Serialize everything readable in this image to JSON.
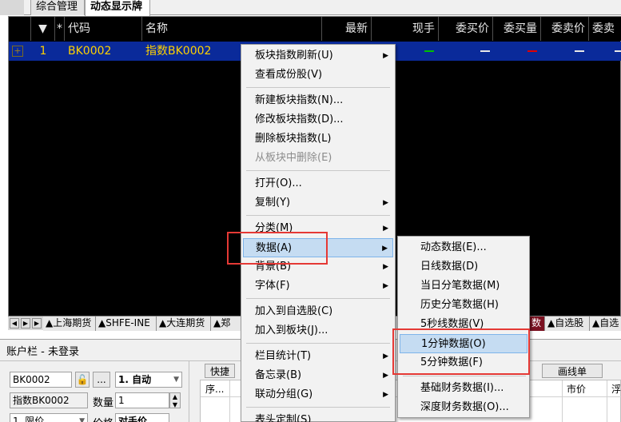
{
  "top_tabs": [
    {
      "label": "综合管理"
    },
    {
      "label": "动态显示牌"
    }
  ],
  "grid": {
    "headers": {
      "sort": "▼",
      "star": "*",
      "code": "代码",
      "name": "名称",
      "latest": "最新",
      "current": "现手",
      "bid_price": "委买价",
      "bid_vol": "委买量",
      "ask_price": "委卖价",
      "ask_vol": "委卖"
    },
    "row": {
      "expand": "+",
      "index": "1",
      "code": "BK0002",
      "name": "指数BK0002"
    },
    "colors": {
      "bg": "#000000",
      "row_bg": "#0a2a9a",
      "row_text": "#ffd200",
      "green": "#00c000",
      "red": "#e00000"
    }
  },
  "category_tabs": {
    "tabs": [
      {
        "label": "▲上海期货"
      },
      {
        "label": "▲SHFE-INE"
      },
      {
        "label": "▲大连期货"
      },
      {
        "label": "▲郑"
      }
    ],
    "right_tabs": [
      {
        "label": "数"
      },
      {
        "label": "▲自选股"
      },
      {
        "label": "▲自选"
      }
    ]
  },
  "account": {
    "title": "账户栏 - 未登录",
    "code_value": "BK0002",
    "dots": "...",
    "mode": "1. 自动",
    "name_value": "指数BK0002",
    "qty_label": "数量",
    "qty_value": "1",
    "order_type": "1. 限价",
    "price_label": "价格",
    "price_value": "对手价",
    "quick_button": "快捷",
    "draw_button": "画线单",
    "col_seq": "序...",
    "col_market": "市价",
    "col_last": "浮"
  },
  "context_menu": {
    "items": [
      {
        "label": "板块指数刷新(U)",
        "arrow": "▶",
        "disabled": false
      },
      {
        "label": "查看成份股(V)",
        "arrow": "",
        "disabled": false
      },
      {
        "label": "新建板块指数(N)...",
        "arrow": "",
        "disabled": false
      },
      {
        "label": "修改板块指数(D)...",
        "arrow": "",
        "disabled": false
      },
      {
        "label": "删除板块指数(L)",
        "arrow": "",
        "disabled": false
      },
      {
        "label": "从板块中删除(E)",
        "arrow": "",
        "disabled": true
      },
      {
        "label": "打开(O)...",
        "arrow": "",
        "disabled": false
      },
      {
        "label": "复制(Y)",
        "arrow": "▶",
        "disabled": false
      },
      {
        "label": "分类(M)",
        "arrow": "▶",
        "disabled": false
      },
      {
        "label": "数据(A)",
        "arrow": "▶",
        "disabled": false,
        "highlight": true
      },
      {
        "label": "背景(B)",
        "arrow": "▶",
        "disabled": false
      },
      {
        "label": "字体(F)",
        "arrow": "▶",
        "disabled": false
      },
      {
        "label": "加入到自选股(C)",
        "arrow": "",
        "disabled": false
      },
      {
        "label": "加入到板块(J)...",
        "arrow": "",
        "disabled": false
      },
      {
        "label": "栏目统计(T)",
        "arrow": "▶",
        "disabled": false
      },
      {
        "label": "备忘录(B)",
        "arrow": "▶",
        "disabled": false
      },
      {
        "label": "联动分组(G)",
        "arrow": "▶",
        "disabled": false
      },
      {
        "label": "表头定制(S)",
        "arrow": "",
        "disabled": false
      }
    ]
  },
  "sub_menu": {
    "items": [
      {
        "label": "动态数据(E)..."
      },
      {
        "label": "日线数据(D)"
      },
      {
        "label": "当日分笔数据(M)"
      },
      {
        "label": "历史分笔数据(H)"
      },
      {
        "label": "5秒线数据(V)"
      },
      {
        "label": "1分钟数据(O)",
        "highlight": true
      },
      {
        "label": "5分钟数据(F)"
      },
      {
        "label": "基础财务数据(I)..."
      },
      {
        "label": "深度财务数据(O)..."
      }
    ]
  }
}
